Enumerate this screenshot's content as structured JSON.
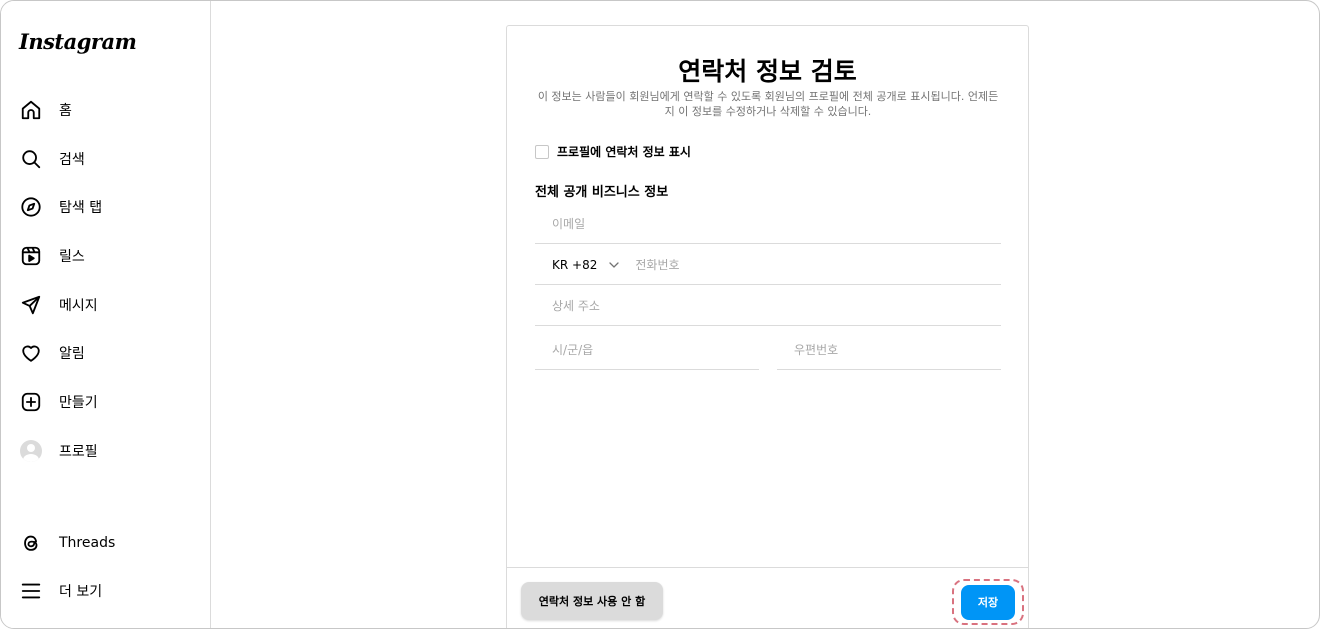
{
  "sidebar": {
    "logo": "Instagram",
    "items": [
      {
        "label": "홈",
        "icon": "home-icon"
      },
      {
        "label": "검색",
        "icon": "search-icon"
      },
      {
        "label": "탐색 탭",
        "icon": "compass-icon"
      },
      {
        "label": "릴스",
        "icon": "reels-icon"
      },
      {
        "label": "메시지",
        "icon": "send-icon"
      },
      {
        "label": "알림",
        "icon": "heart-icon"
      },
      {
        "label": "만들기",
        "icon": "plus-square-icon"
      },
      {
        "label": "프로필",
        "icon": "avatar-icon"
      }
    ],
    "bottom_items": [
      {
        "label": "Threads",
        "icon": "threads-icon"
      },
      {
        "label": "더 보기",
        "icon": "menu-icon"
      }
    ]
  },
  "form": {
    "title": "연락처 정보 검토",
    "subtitle": "이 정보는 사람들이 회원님에게 연락할 수 있도록 회원님의 프로필에 전체 공개로 표시됩니다. 언제든지 이 정보를 수정하거나 삭제할 수 있습니다.",
    "checkbox_label": "프로필에 연락처 정보 표시",
    "checkbox_checked": false,
    "section_label": "전체 공개 비즈니스 정보",
    "email_placeholder": "이메일",
    "country_code": "KR +82",
    "phone_placeholder": "전화번호",
    "address_placeholder": "상세 주소",
    "city_placeholder": "시/군/읍",
    "zip_placeholder": "우편번호",
    "secondary_button": "연락처 정보 사용 안 함",
    "primary_button": "저장"
  },
  "colors": {
    "primary": "#0095f6",
    "border": "#dbdbdb",
    "muted_text": "#737373",
    "placeholder": "#a8a8a8",
    "highlight": "#d9727f"
  }
}
